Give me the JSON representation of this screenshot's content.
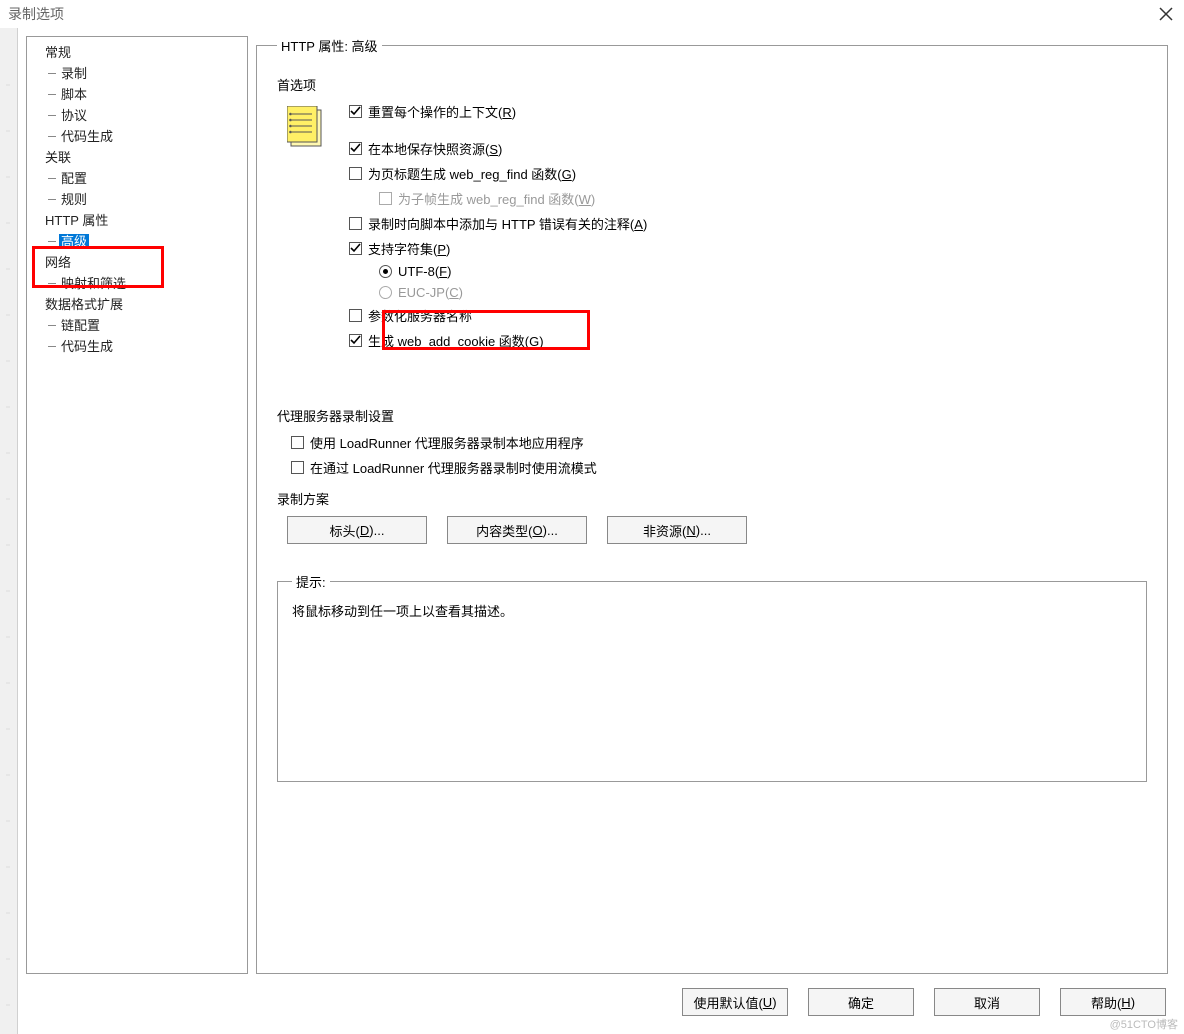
{
  "title": "录制选项",
  "tree": {
    "general": {
      "label": "常规",
      "children": {
        "record": "录制",
        "script": "脚本",
        "protocol": "协议",
        "codegen": "代码生成"
      }
    },
    "correlation": {
      "label": "关联",
      "children": {
        "config": "配置",
        "rule": "规则"
      }
    },
    "http": {
      "label": "HTTP 属性",
      "children": {
        "advanced": "高级"
      }
    },
    "network": {
      "label": "网络",
      "children": {
        "mapfilter": "映射和筛选"
      }
    },
    "dataformat": {
      "label": "数据格式扩展",
      "children": {
        "chain": "链配置",
        "codegen2": "代码生成"
      }
    }
  },
  "panel": {
    "legend": "HTTP 属性: 高级",
    "pref_label": "首选项",
    "opts": {
      "reset_ctx": {
        "label_pre": "重置每个操作的上下文(",
        "accel": "R",
        "label_post": ")",
        "checked": true
      },
      "save_snapshot": {
        "label_pre": "在本地保存快照资源(",
        "accel": "S",
        "label_post": ")",
        "checked": true
      },
      "gen_webregfind": {
        "label_pre": "为页标题生成 web_reg_find 函数(",
        "accel": "G",
        "label_post": ")",
        "checked": false
      },
      "gen_webregfind_sub": {
        "label_pre": "为子帧生成 web_reg_find 函数(",
        "accel": "W",
        "label_post": ")",
        "checked": false,
        "disabled": true
      },
      "add_http_err": {
        "label_pre": "录制时向脚本中添加与 HTTP 错误有关的注释(",
        "accel": "A",
        "label_post": ")",
        "checked": false
      },
      "charset": {
        "label_pre": "支持字符集(",
        "accel": "P",
        "label_post": ")",
        "checked": true
      },
      "utf8": {
        "label_pre": "UTF-8(",
        "accel": "F",
        "label_post": ")",
        "selected": true
      },
      "eucjp": {
        "label_pre": "EUC-JP(",
        "accel": "C",
        "label_post": ")",
        "selected": false,
        "disabled": true
      },
      "param_server": {
        "label": "参数化服务器名称",
        "checked": false
      },
      "gen_cookie": {
        "label_pre": "生成 web_add_cookie 函数(",
        "accel": "G",
        "label_post": ")",
        "checked": true
      }
    },
    "proxy": {
      "label": "代理服务器录制设置",
      "use_lr_proxy": "使用 LoadRunner 代理服务器录制本地应用程序",
      "stream_mode": "在通过 LoadRunner 代理服务器录制时使用流模式"
    },
    "scheme": {
      "label": "录制方案",
      "headers": {
        "pre": "标头(",
        "a": "D",
        "post": ")..."
      },
      "content": {
        "pre": "内容类型(",
        "a": "O",
        "post": ")..."
      },
      "nonres": {
        "pre": "非资源(",
        "a": "N",
        "post": ")..."
      }
    },
    "hint": {
      "legend": "提示:",
      "text": "将鼠标移动到任一项上以查看其描述。"
    }
  },
  "footer": {
    "defaults": {
      "pre": "使用默认值(",
      "a": "U",
      "post": ")"
    },
    "ok": "确定",
    "cancel": "取消",
    "help": {
      "pre": "帮助(",
      "a": "H",
      "post": ")"
    }
  },
  "watermark": "@51CTO博客"
}
